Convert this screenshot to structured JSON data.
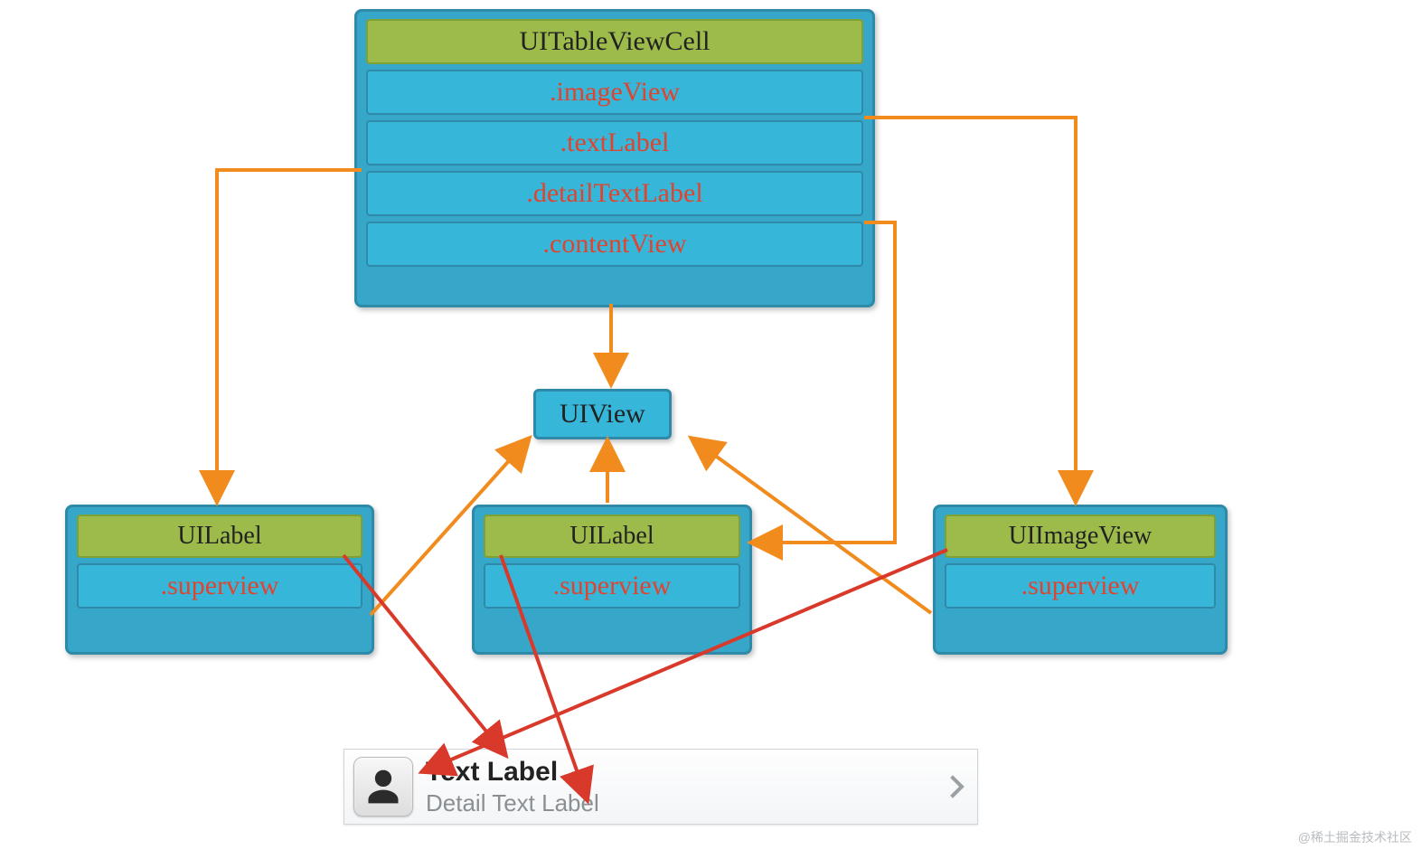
{
  "topBox": {
    "title": "UITableViewCell",
    "rows": [
      ".imageView",
      ".textLabel",
      ".detailTextLabel",
      ".contentView"
    ]
  },
  "uiview": {
    "label": "UIView"
  },
  "leftBox": {
    "title": "UILabel",
    "row": ".superview"
  },
  "middleBox": {
    "title": "UILabel",
    "row": ".superview"
  },
  "rightBox": {
    "title": "UIImageView",
    "row": ".superview"
  },
  "cell": {
    "title": "Text Label",
    "subtitle": "Detail Text Label"
  },
  "watermark": "@稀土掘金技术社区",
  "colors": {
    "orange": "#f28b1d",
    "red": "#d8392a"
  }
}
